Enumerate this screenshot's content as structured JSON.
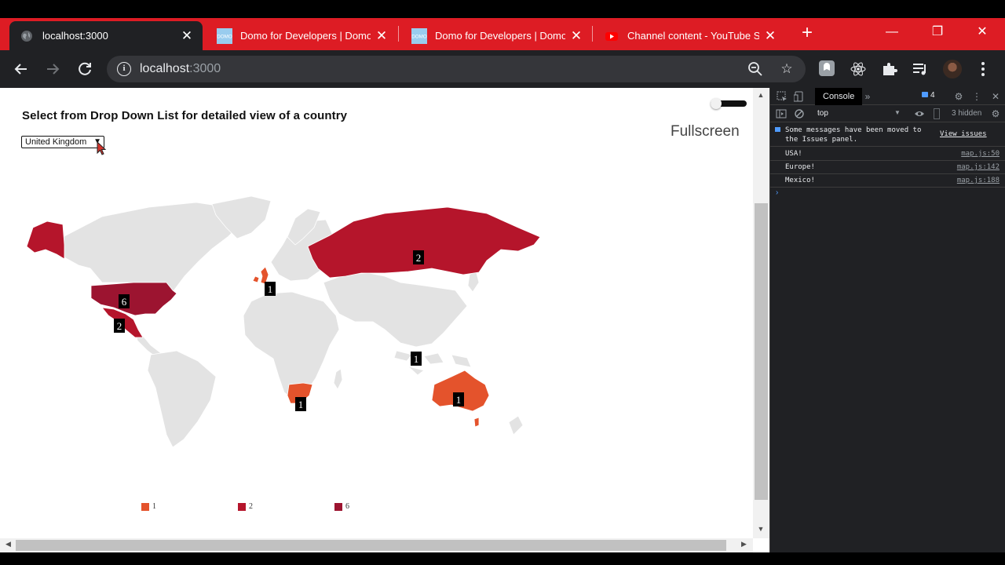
{
  "browser": {
    "tabs": [
      {
        "title": "localhost:3000",
        "favicon": "globe-icon"
      },
      {
        "title": "Domo for Developers | Domo",
        "favicon": "domo-icon"
      },
      {
        "title": "Domo for Developers | Domo",
        "favicon": "domo-icon"
      },
      {
        "title": "Channel content - YouTube Studio",
        "favicon": "youtube-icon"
      }
    ],
    "address": {
      "host": "localhost",
      "port": ":3000"
    },
    "colors": {
      "tab_strip": "#dd1c24",
      "toolbar": "#202124"
    }
  },
  "page": {
    "heading": "Select from Drop Down List for detailed view of a country",
    "select_value": "United Kingdom",
    "fullscreen_label": "Fullscreen",
    "markers": [
      {
        "country": "USA",
        "label": "6"
      },
      {
        "country": "Mexico",
        "label": "2"
      },
      {
        "country": "Russia",
        "label": "2"
      },
      {
        "country": "United Kingdom",
        "label": "1"
      },
      {
        "country": "Indonesia",
        "label": "1"
      },
      {
        "country": "South Africa",
        "label": "1"
      },
      {
        "country": "Australia",
        "label": "1"
      }
    ],
    "legend": [
      {
        "label": "1",
        "color": "#e4532c"
      },
      {
        "label": "2",
        "color": "#b5152b"
      },
      {
        "label": "6",
        "color": "#9c1430"
      }
    ]
  },
  "devtools": {
    "tab": "Console",
    "issue_count": "4",
    "context": "top",
    "hidden_label": "3 hidden",
    "issue_message": "Some messages have been moved to the Issues panel.",
    "issue_link": "View issues",
    "logs": [
      {
        "text": "USA!",
        "source": "map.js:50"
      },
      {
        "text": "Europe!",
        "source": "map.js:142"
      },
      {
        "text": "Mexico!",
        "source": "map.js:188"
      }
    ]
  }
}
